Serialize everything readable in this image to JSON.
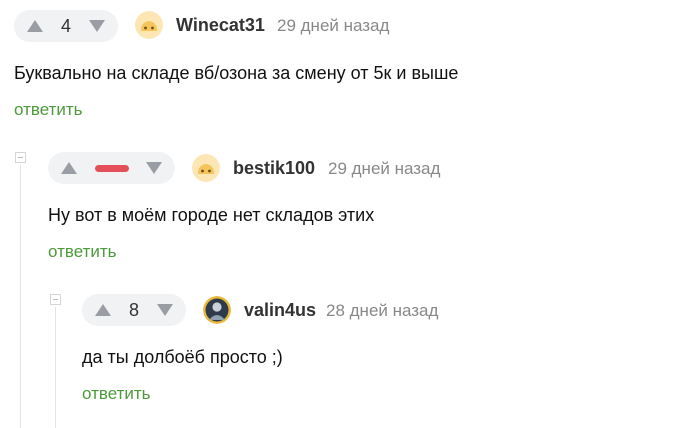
{
  "comments": [
    {
      "rating": "4",
      "username": "Winecat31",
      "time": "29 дней назад",
      "text": "Буквально на складе вб/озона за смену от 5к и выше",
      "reply": "ответить"
    },
    {
      "rating": "",
      "rating_state": "negative",
      "username": "bestik100",
      "time": "29 дней назад",
      "text": "Ну вот в моём городе нет складов этих",
      "reply": "ответить"
    },
    {
      "rating": "8",
      "username": "valin4us",
      "time": "28 дней назад",
      "text": "да ты долбоёб просто ;)",
      "reply": "ответить"
    }
  ],
  "colors": {
    "reply_link": "#4c9a3a",
    "negative_rating": "#e4505a",
    "vote_bg": "#f1f2f4"
  },
  "icons": {
    "upvote": "triangle-up",
    "downvote": "triangle-down",
    "collapse": "minus-square"
  }
}
